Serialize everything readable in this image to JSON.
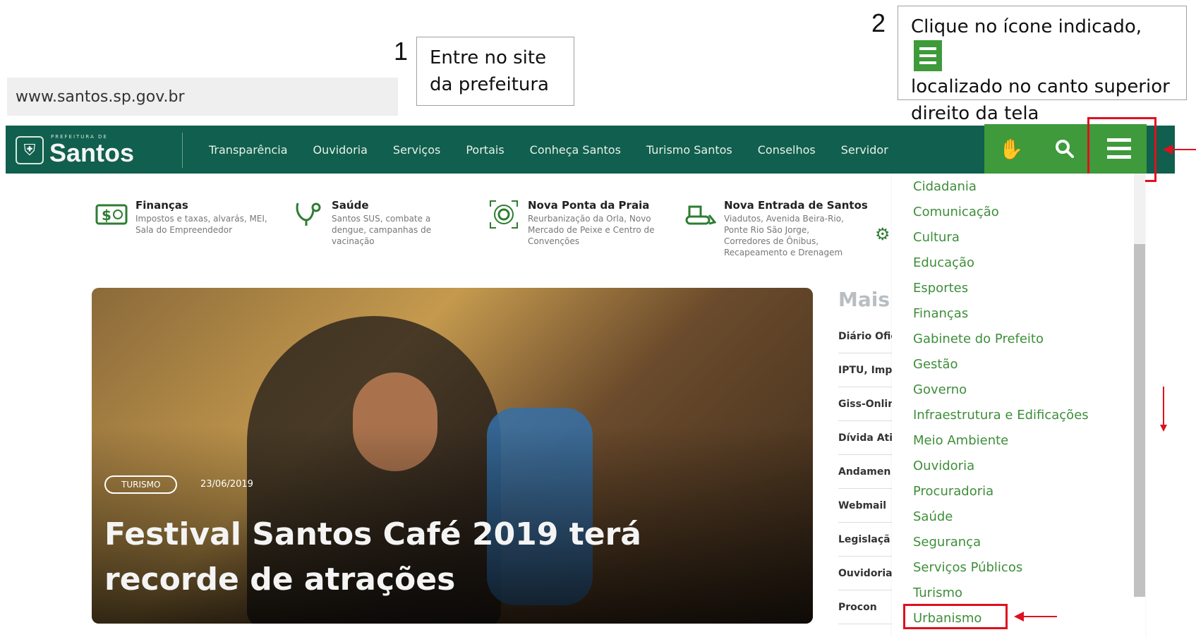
{
  "url_bar": {
    "text": "www.santos.sp.gov.br"
  },
  "instructions": {
    "step1": {
      "number": "1",
      "text_line1": "Entre no site",
      "text_line2": "da prefeitura"
    },
    "step2": {
      "number": "2",
      "text_line1": "Clique no ícone indicado,",
      "text_line2": "localizado no canto superior",
      "text_line3": "direito da tela"
    }
  },
  "header": {
    "logo_small": "PREFEITURA DE",
    "logo_big": "Santos",
    "nav": [
      "Transparência",
      "Ouvidoria",
      "Serviços",
      "Portais",
      "Conheça Santos",
      "Turismo Santos",
      "Conselhos",
      "Servidor"
    ],
    "icons": [
      "sign-language-icon",
      "search-icon",
      "menu-icon"
    ]
  },
  "quick_links": [
    {
      "title": "Finanças",
      "desc": "Impostos e taxas, alvarás, MEI, Sala do Empreendedor",
      "icon": "money-icon"
    },
    {
      "title": "Saúde",
      "desc": "Santos SUS, combate a dengue, campanhas de vacinação",
      "icon": "stethoscope-icon"
    },
    {
      "title": "Nova Ponta da Praia",
      "desc": "Reurbanização da Orla, Novo Mercado de Peixe e Centro de Convenções",
      "icon": "focus-icon"
    },
    {
      "title": "Nova Entrada de Santos",
      "desc": "Viadutos, Avenida Beira-Rio, Ponte Rio São Jorge, Corredores de Ônibus, Recapeamento e Drenagem",
      "icon": "bulldozer-icon"
    }
  ],
  "hero": {
    "tag": "TURISMO",
    "date": "23/06/2019",
    "title": "Festival Santos Café 2019 terá recorde de atrações"
  },
  "side": {
    "heading": "Mais A",
    "items": [
      "Diário Ofic",
      "IPTU, Imp",
      "Giss-Onlin",
      "Dívida Ati",
      "Andamen",
      "Webmail",
      "Legislaçã",
      "Ouvidoria",
      "Procon"
    ]
  },
  "dropdown": {
    "items": [
      "Cidadania",
      "Comunicação",
      "Cultura",
      "Educação",
      "Esportes",
      "Finanças",
      "Gabinete do Prefeito",
      "Gestão",
      "Governo",
      "Infraestrutura e Edificações",
      "Meio Ambiente",
      "Ouvidoria",
      "Procuradoria",
      "Saúde",
      "Segurança",
      "Serviços Públicos",
      "Turismo",
      "Urbanismo"
    ],
    "highlighted": "Urbanismo"
  },
  "colors": {
    "header_bg": "#115f4e",
    "accent_green": "#3e9a3a",
    "link_green": "#3e8e3a",
    "annotation_red": "#e0101e"
  }
}
